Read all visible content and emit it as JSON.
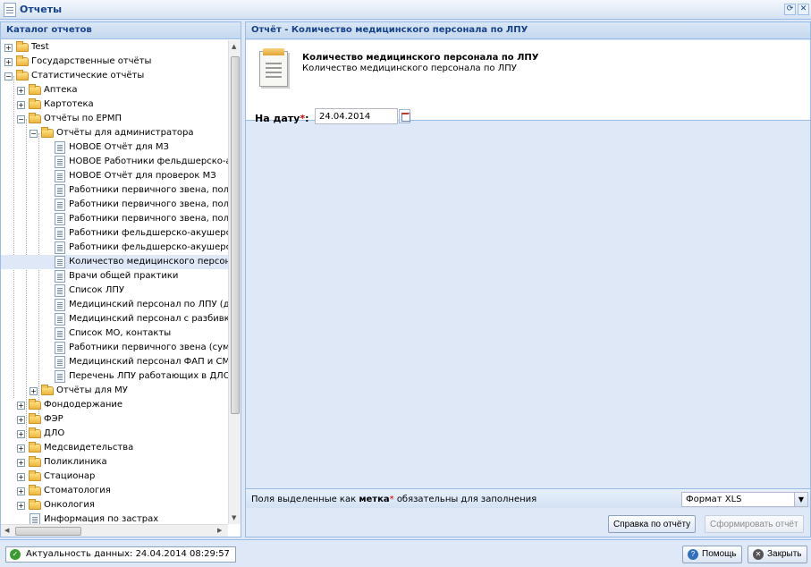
{
  "window": {
    "title": "Отчеты"
  },
  "catalog": {
    "title": "Каталог отчетов",
    "items": [
      {
        "label": "Test",
        "level": 0,
        "type": "folder",
        "exp": "+"
      },
      {
        "label": "Государственные отчёты",
        "level": 0,
        "type": "folder",
        "exp": "+"
      },
      {
        "label": "Статистические отчёты",
        "level": 0,
        "type": "folder",
        "exp": "−"
      },
      {
        "label": "Аптека",
        "level": 1,
        "type": "folder",
        "exp": "+"
      },
      {
        "label": "Картотека",
        "level": 1,
        "type": "folder",
        "exp": "+"
      },
      {
        "label": "Отчёты по ЕРМП",
        "level": 1,
        "type": "folder",
        "exp": "−"
      },
      {
        "label": "Отчёты для администратора",
        "level": 2,
        "type": "folder",
        "exp": "−"
      },
      {
        "label": "НОВОЕ Отчёт для МЗ",
        "level": 3,
        "type": "doc"
      },
      {
        "label": "НОВОЕ Работники фельдшерско-ак",
        "level": 3,
        "type": "doc"
      },
      {
        "label": "НОВОЕ Отчёт для проверок МЗ",
        "level": 3,
        "type": "doc"
      },
      {
        "label": "Работники первичного звена, получ",
        "level": 3,
        "type": "doc"
      },
      {
        "label": "Работники первичного звена, получ",
        "level": 3,
        "type": "doc"
      },
      {
        "label": "Работники первичного звена, получ",
        "level": 3,
        "type": "doc"
      },
      {
        "label": "Работники фельдшерско-акушерск",
        "level": 3,
        "type": "doc"
      },
      {
        "label": "Работники фельдшерско-акушерск",
        "level": 3,
        "type": "doc"
      },
      {
        "label": "Количество медицинского персонал",
        "level": 3,
        "type": "doc",
        "selected": true
      },
      {
        "label": "Врачи общей практики",
        "level": 3,
        "type": "doc"
      },
      {
        "label": "Список ЛПУ",
        "level": 3,
        "type": "doc"
      },
      {
        "label": "Медицинский персонал по ЛПУ (для",
        "level": 3,
        "type": "doc"
      },
      {
        "label": "Медицинский персонал с разбивко",
        "level": 3,
        "type": "doc"
      },
      {
        "label": "Список МО, контакты",
        "level": 3,
        "type": "doc"
      },
      {
        "label": "Работники первичного звена (сумме",
        "level": 3,
        "type": "doc"
      },
      {
        "label": "Медицинский персонал ФАП и СМП",
        "level": 3,
        "type": "doc"
      },
      {
        "label": "Перечень ЛПУ работающих в ДЛО",
        "level": 3,
        "type": "doc"
      },
      {
        "label": "Отчёты для МУ",
        "level": 2,
        "type": "folder",
        "exp": "+"
      },
      {
        "label": "Фондодержание",
        "level": 1,
        "type": "folder",
        "exp": "+"
      },
      {
        "label": "ФЭР",
        "level": 1,
        "type": "folder",
        "exp": "+"
      },
      {
        "label": "ДЛО",
        "level": 1,
        "type": "folder",
        "exp": "+"
      },
      {
        "label": "Медсвидетельства",
        "level": 1,
        "type": "folder",
        "exp": "+"
      },
      {
        "label": "Поликлиника",
        "level": 1,
        "type": "folder",
        "exp": "+"
      },
      {
        "label": "Стационар",
        "level": 1,
        "type": "folder",
        "exp": "+"
      },
      {
        "label": "Стоматология",
        "level": 1,
        "type": "folder",
        "exp": "+"
      },
      {
        "label": "Онкология",
        "level": 1,
        "type": "folder",
        "exp": "+"
      },
      {
        "label": "Информация по застрах",
        "level": 1,
        "type": "doc"
      }
    ]
  },
  "report": {
    "panel_title": "Отчёт - Количество медицинского персонала по ЛПУ",
    "title": "Количество медицинского персонала по ЛПУ",
    "subtitle": "Количество медицинского персонала по ЛПУ",
    "date_label": "На дату",
    "date_req_mark": "*",
    "date_colon": ":",
    "date_value": "24.04.2014",
    "note_prefix": "Поля выделенные как",
    "note_mark_word": "метка",
    "note_req_mark": "*",
    "note_suffix": "обязательны для заполнения",
    "format_value": "Формат XLS",
    "help_btn": "Справка по отчёту",
    "generate_btn": "Сформировать отчёт"
  },
  "status": {
    "freshness": "Актуальность данных: 24.04.2014 08:29:57",
    "help": "Помощь",
    "close": "Закрыть"
  }
}
